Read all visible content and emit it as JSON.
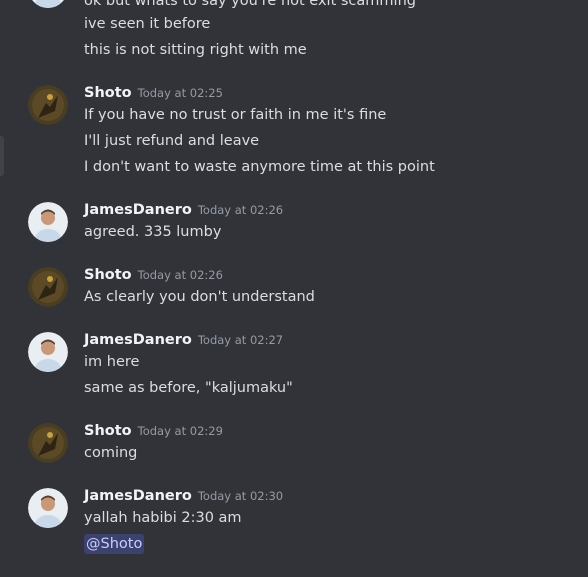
{
  "messages": {
    "partial_top": "ok but whats to say you're not exit scamming",
    "line_seen": "ive seen it before",
    "line_not_right": "this is not sitting right with me",
    "g1": {
      "author": "Shoto",
      "time": "Today at 02:25",
      "lines": [
        "If you have no trust or faith in me it's fine",
        "I'll just refund and leave",
        "I don't want to waste anymore time at this point"
      ]
    },
    "g2": {
      "author": "JamesDanero",
      "time": "Today at 02:26",
      "lines": [
        "agreed. 335 lumby"
      ]
    },
    "g3": {
      "author": "Shoto",
      "time": "Today at 02:26",
      "lines": [
        "As clearly you don't understand"
      ]
    },
    "g4": {
      "author": "JamesDanero",
      "time": "Today at 02:27",
      "lines": [
        "im here",
        "same as before, \"kaljumaku\""
      ]
    },
    "g5": {
      "author": "Shoto",
      "time": "Today at 02:29",
      "lines": [
        "coming"
      ]
    },
    "g6": {
      "author": "JamesDanero",
      "time": "Today at 02:30",
      "lines": [
        "yallah habibi 2:30 am"
      ],
      "mention": "@Shoto"
    }
  },
  "colors": {
    "background": "#313338",
    "text": "#dbdee1",
    "author": "#f2f3f5",
    "timestamp": "#949ba4",
    "mention_bg": "#3c4270",
    "mention_text": "#c9cdfb"
  },
  "icons": {
    "shoto_avatar": "avatar-shoto-icon",
    "james_avatar": "avatar-james-icon"
  }
}
